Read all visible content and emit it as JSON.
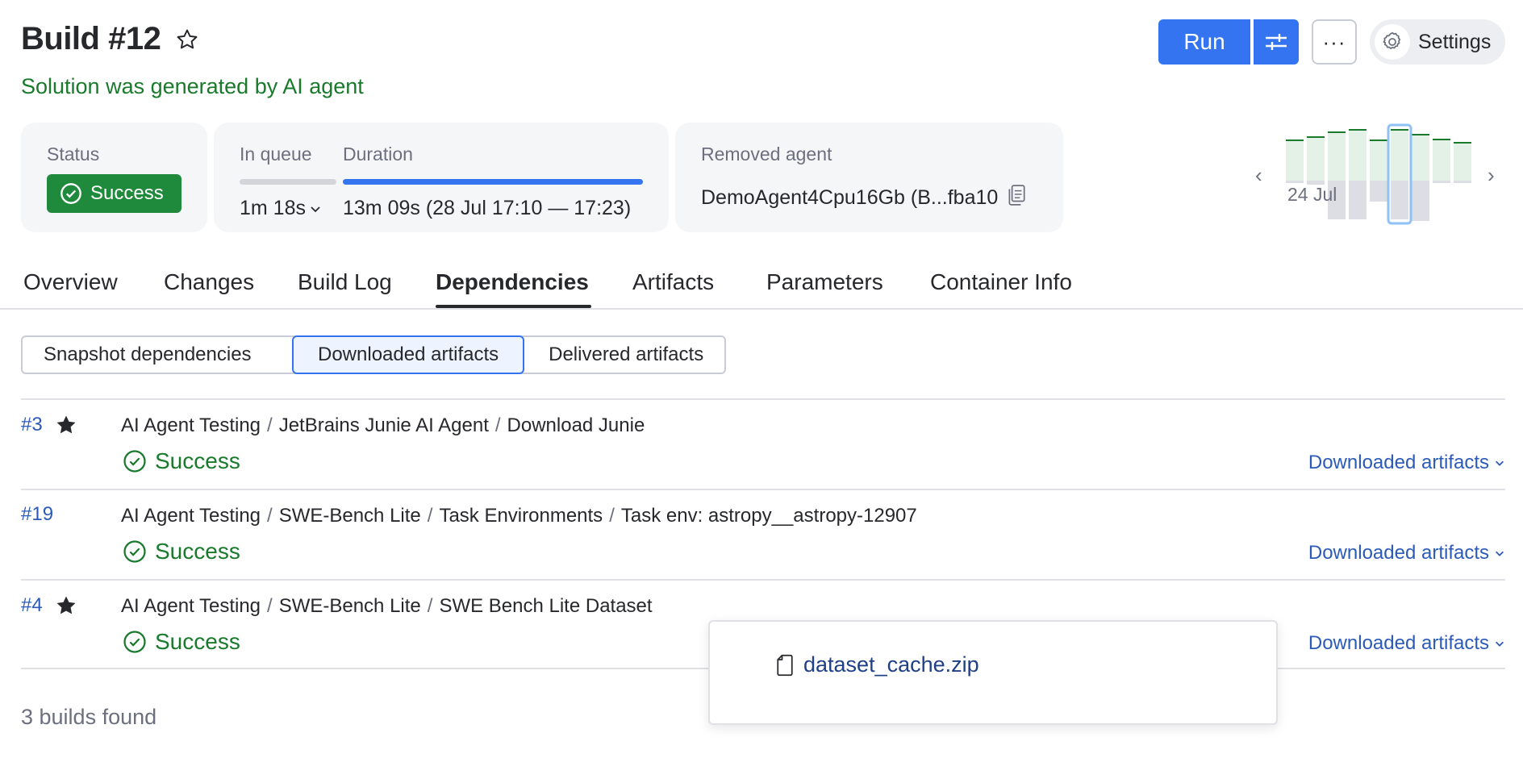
{
  "header": {
    "title": "Build #12",
    "subtitle": "Solution was generated by AI agent",
    "run_label": "Run",
    "more_label": "···",
    "settings_label": "Settings"
  },
  "status_card": {
    "label": "Status",
    "value": "Success"
  },
  "queue_card": {
    "queue_label": "In queue",
    "queue_value": "1m 18s",
    "duration_label": "Duration",
    "duration_value": "13m 09s (28 Jul 17:10 — 17:23)"
  },
  "agent_card": {
    "label": "Removed agent",
    "value": "DemoAgent4Cpu16Gb (B...fba10"
  },
  "history": {
    "date_label": "24 Jul"
  },
  "tabs": [
    {
      "label": "Overview"
    },
    {
      "label": "Changes"
    },
    {
      "label": "Build Log"
    },
    {
      "label": "Dependencies",
      "active": true
    },
    {
      "label": "Artifacts"
    },
    {
      "label": "Parameters"
    },
    {
      "label": "Container Info"
    }
  ],
  "segments": [
    {
      "label": "Snapshot dependencies"
    },
    {
      "label": "Downloaded artifacts",
      "selected": true
    },
    {
      "label": "Delivered artifacts"
    }
  ],
  "rows": [
    {
      "number": "#3",
      "starred": true,
      "path": [
        "AI Agent Testing",
        "JetBrains Junie AI Agent",
        "Download Junie"
      ],
      "status": "Success",
      "dl_label": "Downloaded artifacts"
    },
    {
      "number": "#19",
      "starred": false,
      "path": [
        "AI Agent Testing",
        "SWE-Bench Lite",
        "Task Environments",
        "Task env: astropy__astropy-12907"
      ],
      "status": "Success",
      "dl_label": "Downloaded artifacts"
    },
    {
      "number": "#4",
      "starred": true,
      "path": [
        "AI Agent Testing",
        "SWE-Bench Lite",
        "SWE Bench Lite Dataset"
      ],
      "status": "Success",
      "dl_label": "Downloaded artifacts"
    }
  ],
  "popup": {
    "file_name": "dataset_cache.zip"
  },
  "footer": {
    "text": "3 builds found"
  },
  "colors": {
    "accent": "#3574f0",
    "success": "#208a3c",
    "success_text": "#1a7a2c",
    "link": "#2b5ab8"
  }
}
